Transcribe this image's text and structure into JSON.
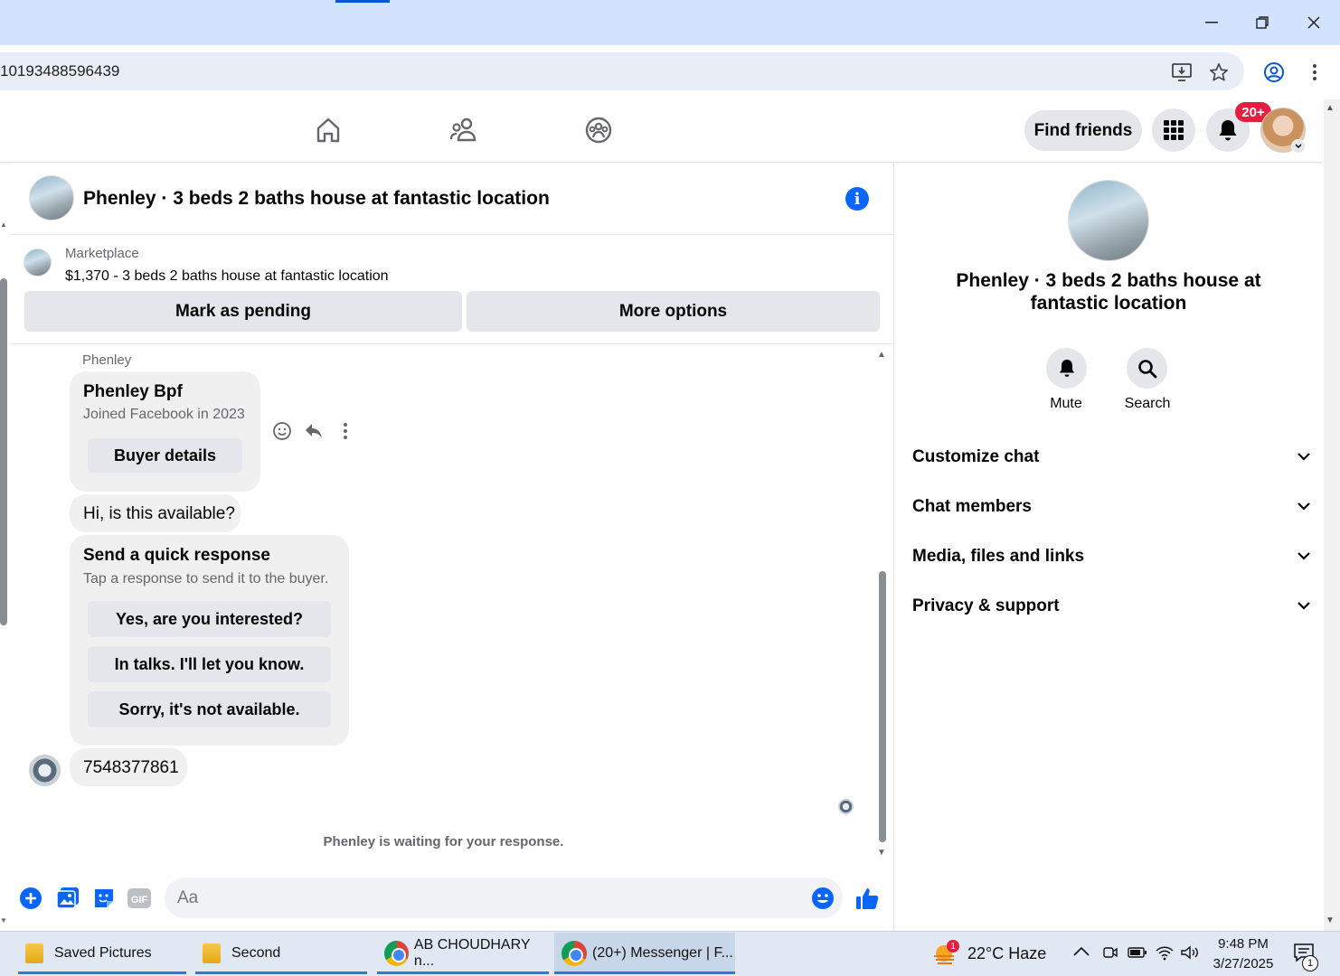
{
  "browser": {
    "url_fragment": "10193488596439",
    "window_controls": [
      "minimize",
      "restore",
      "close"
    ]
  },
  "topnav": {
    "find_friends": "Find friends",
    "notification_badge": "20+"
  },
  "chat": {
    "title": "Phenley · 3 beds 2 baths house at fantastic location",
    "marketplace_label": "Marketplace",
    "listing": "$1,370 - 3 beds 2 baths house at fantastic location",
    "mark_pending": "Mark as pending",
    "more_options": "More options",
    "sender_name": "Phenley",
    "buyer_card": {
      "name": "Phenley Bpf",
      "joined": "Joined Facebook in 2023",
      "button": "Buyer details"
    },
    "message_available": "Hi, is this available?",
    "quick_response": {
      "title": "Send a quick response",
      "subtitle": "Tap a response to send it to the buyer.",
      "options": [
        "Yes, are you interested?",
        "In talks. I'll let you know.",
        "Sorry, it's not available."
      ]
    },
    "phone_message": "7548377861",
    "waiting_status": "Phenley is waiting for your response.",
    "composer_placeholder": "Aa"
  },
  "details_panel": {
    "title": "Phenley · 3 beds 2 baths house at fantastic location",
    "mute": "Mute",
    "search": "Search",
    "sections": [
      "Customize chat",
      "Chat members",
      "Media, files and links",
      "Privacy & support"
    ]
  },
  "taskbar": {
    "items": [
      "Saved Pictures",
      "Second",
      "AB CHOUDHARY n...",
      "(20+) Messenger | F..."
    ],
    "weather_badge": "1",
    "weather": "22°C  Haze",
    "time": "9:48 PM",
    "date": "3/27/2025",
    "notification_count": "1"
  },
  "colors": {
    "accent": "#0866ff",
    "badge_red": "#e41e3f",
    "titlebar": "#d3e3fd",
    "bubble": "#f0f0f0"
  }
}
